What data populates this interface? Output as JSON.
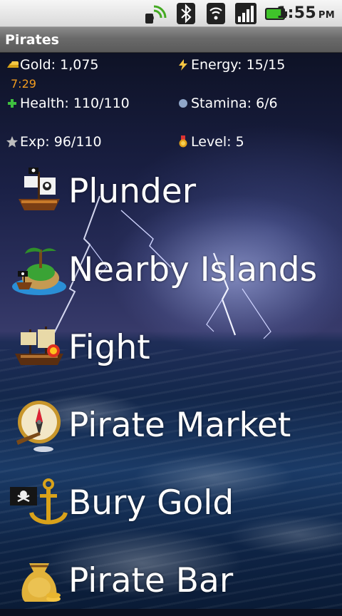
{
  "status_bar": {
    "icons": [
      "signal-waves-icon",
      "bluetooth-icon",
      "wifi-icon",
      "cell-signal-icon",
      "battery-icon"
    ],
    "time": "1:55",
    "ampm": "PM"
  },
  "app": {
    "title": "Pirates"
  },
  "stats": {
    "gold": "Gold: 1,075",
    "timer": "7:29",
    "energy": "Energy: 15/15",
    "health": "Health: 110/110",
    "stamina": "Stamina: 6/6",
    "exp": "Exp: 96/110",
    "level": "Level: 5"
  },
  "menu": [
    {
      "label": "Plunder",
      "icon": "pirate-ship-icon"
    },
    {
      "label": "Nearby Islands",
      "icon": "island-icon"
    },
    {
      "label": "Fight",
      "icon": "battle-ship-icon"
    },
    {
      "label": "Pirate Market",
      "icon": "compass-icon"
    },
    {
      "label": "Bury Gold",
      "icon": "anchor-flag-icon"
    },
    {
      "label": "Pirate Bar",
      "icon": "gold-sack-icon"
    }
  ],
  "colors": {
    "timer": "#f39c1e",
    "health": "#3fbf3f",
    "energy": "#f5c542"
  }
}
